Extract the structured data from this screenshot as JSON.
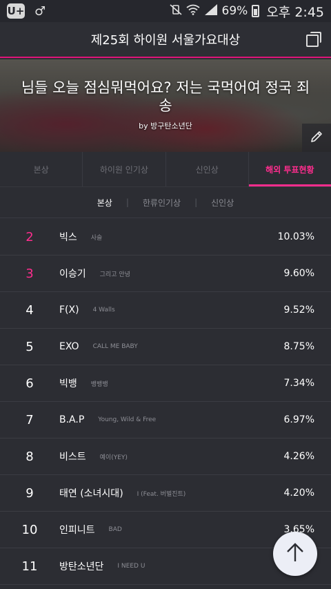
{
  "status_bar": {
    "carrier_badge": "U+",
    "battery": "69%",
    "time": "오후 2:45",
    "icons": [
      "vibrate-off-icon",
      "wifi-icon",
      "signal-icon",
      "battery-charging-icon"
    ]
  },
  "header": {
    "title": "제25회 하이원 서울가요대상",
    "action_icon": "copy-icon"
  },
  "banner": {
    "text": "님들 오늘 점심뭐먹어요? 저는 국먹어여 정국 죄송",
    "by": "by 방구탄소년단",
    "edit_icon": "pencil-icon"
  },
  "tabs": [
    {
      "label": "본상",
      "active": false
    },
    {
      "label": "하이원 인기상",
      "active": false
    },
    {
      "label": "신인상",
      "active": false
    },
    {
      "label": "해외 투표현황",
      "active": true
    }
  ],
  "subtabs": [
    {
      "label": "본상",
      "active": true
    },
    {
      "label": "한류인기상",
      "active": false
    },
    {
      "label": "신인상",
      "active": false
    }
  ],
  "ranking": [
    {
      "rank": "2",
      "artist": "빅스",
      "song": "사슬",
      "percent": "10.03%",
      "highlight": true
    },
    {
      "rank": "3",
      "artist": "이승기",
      "song": "그리고 안녕",
      "percent": "9.60%",
      "highlight": true
    },
    {
      "rank": "4",
      "artist": "F(X)",
      "song": "4 Walls",
      "percent": "9.52%",
      "highlight": false
    },
    {
      "rank": "5",
      "artist": "EXO",
      "song": "CALL ME BABY",
      "percent": "8.75%",
      "highlight": false
    },
    {
      "rank": "6",
      "artist": "빅뱅",
      "song": "뱅뱅뱅",
      "percent": "7.34%",
      "highlight": false
    },
    {
      "rank": "7",
      "artist": "B.A.P",
      "song": "Young, Wild & Free",
      "percent": "6.97%",
      "highlight": false
    },
    {
      "rank": "8",
      "artist": "비스트",
      "song": "예이(YEY)",
      "percent": "4.26%",
      "highlight": false
    },
    {
      "rank": "9",
      "artist": "태연 (소녀시대)",
      "song": "I (Feat. 버벌진트)",
      "percent": "4.20%",
      "highlight": false
    },
    {
      "rank": "10",
      "artist": "인피니트",
      "song": "BAD",
      "percent": "3.65%",
      "highlight": false
    },
    {
      "rank": "11",
      "artist": "방탄소년단",
      "song": "I NEED U",
      "percent": "",
      "highlight": false
    }
  ],
  "fab": {
    "icon": "arrow-up-icon"
  },
  "colors": {
    "accent": "#ff2d8e",
    "background": "#2c2d33",
    "header_border": "#e0147a"
  }
}
